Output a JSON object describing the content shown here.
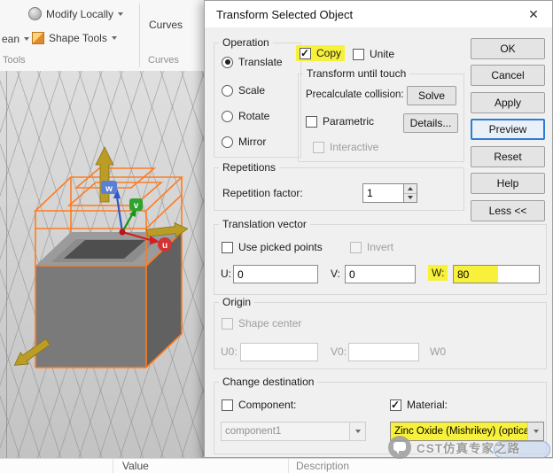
{
  "ribbon": {
    "modify_locally": "Modify Locally",
    "shape_tools": "Shape Tools",
    "boolean_partial": "ean",
    "tools_group": "Tools",
    "curves_button": "Curves",
    "curves_group": "Curves"
  },
  "viewport": {
    "axes": {
      "u": "u",
      "v": "v",
      "w": "w"
    }
  },
  "statusbar": {
    "value": "Value",
    "description": "Description"
  },
  "watermark": {
    "text": "CST仿真专家之路"
  },
  "dialog": {
    "title": "Transform Selected Object",
    "close_glyph": "✕",
    "buttons": {
      "ok": "OK",
      "cancel": "Cancel",
      "apply": "Apply",
      "preview": "Preview",
      "reset": "Reset",
      "help": "Help",
      "less": "Less <<"
    },
    "operation": {
      "legend": "Operation",
      "translate": "Translate",
      "scale": "Scale",
      "rotate": "Rotate",
      "mirror": "Mirror"
    },
    "copy": "Copy",
    "unite": "Unite",
    "touch": {
      "legend": "Transform until touch",
      "precalc": "Precalculate collision:",
      "solve": "Solve",
      "parametric": "Parametric",
      "details": "Details...",
      "interactive": "Interactive"
    },
    "repetitions": {
      "legend": "Repetitions",
      "factor_label": "Repetition factor:",
      "factor_value": "1"
    },
    "translation": {
      "legend": "Translation vector",
      "use_picked": "Use picked points",
      "invert": "Invert",
      "u_label": "U:",
      "u_value": "0",
      "v_label": "V:",
      "v_value": "0",
      "w_label": "W:",
      "w_value": "80"
    },
    "origin": {
      "legend": "Origin",
      "shape_center": "Shape center",
      "u0_label": "U0:",
      "v0_label": "V0:",
      "w0_label": "W0"
    },
    "destination": {
      "legend": "Change destination",
      "component_label": "Component:",
      "component_value": "component1",
      "material_label": "Material:",
      "material_value": "Zinc Oxide (Mishrikey) (optica"
    }
  }
}
